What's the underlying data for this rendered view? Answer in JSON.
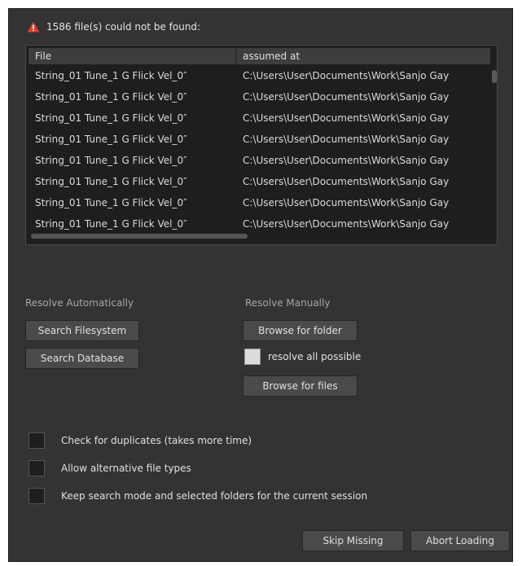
{
  "header": {
    "message": "1586 file(s) could not be found:",
    "icon": "warning-triangle-icon",
    "icon_color": "#e03a2a"
  },
  "table": {
    "columns": [
      "File",
      "assumed at"
    ],
    "rows": [
      {
        "file": "String_01 Tune_1 G Flick Vel_0″",
        "path": "C:\\Users\\User\\Documents\\Work\\Sanjo Gay"
      },
      {
        "file": "String_01 Tune_1 G Flick Vel_0″",
        "path": "C:\\Users\\User\\Documents\\Work\\Sanjo Gay"
      },
      {
        "file": "String_01 Tune_1 G Flick Vel_0″",
        "path": "C:\\Users\\User\\Documents\\Work\\Sanjo Gay"
      },
      {
        "file": "String_01 Tune_1 G Flick Vel_0″",
        "path": "C:\\Users\\User\\Documents\\Work\\Sanjo Gay"
      },
      {
        "file": "String_01 Tune_1 G Flick Vel_0″",
        "path": "C:\\Users\\User\\Documents\\Work\\Sanjo Gay"
      },
      {
        "file": "String_01 Tune_1 G Flick Vel_0″",
        "path": "C:\\Users\\User\\Documents\\Work\\Sanjo Gay"
      },
      {
        "file": "String_01 Tune_1 G Flick Vel_0″",
        "path": "C:\\Users\\User\\Documents\\Work\\Sanjo Gay"
      },
      {
        "file": "String_01 Tune_1 G Flick Vel_0″",
        "path": "C:\\Users\\User\\Documents\\Work\\Sanjo Gay"
      }
    ]
  },
  "resolve_auto": {
    "label": "Resolve Automatically",
    "search_filesystem": "Search Filesystem",
    "search_database": "Search Database"
  },
  "resolve_manual": {
    "label": "Resolve Manually",
    "browse_folder": "Browse for folder",
    "resolve_all": "resolve all possible",
    "browse_files": "Browse for files"
  },
  "options": {
    "check_duplicates": "Check for duplicates (takes more time)",
    "allow_alternative": "Allow alternative file types",
    "keep_search_mode": "Keep search mode and selected folders for the current session"
  },
  "footer": {
    "skip_missing": "Skip Missing",
    "abort_loading": "Abort Loading"
  }
}
